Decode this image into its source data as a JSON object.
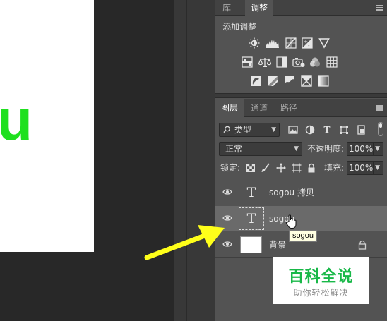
{
  "canvas": {
    "visible_text": "u",
    "text_color": "#1fe01f"
  },
  "adjustments_panel": {
    "tabs": [
      {
        "label": "库",
        "active": false
      },
      {
        "label": "调整",
        "active": true
      }
    ],
    "title": "添加调整",
    "icons": [
      "brightness-contrast-icon",
      "levels-icon",
      "curves-icon",
      "exposure-icon",
      "vibrance-icon",
      "hue-saturation-icon",
      "color-balance-icon",
      "black-white-icon",
      "photo-filter-icon",
      "channel-mixer-icon",
      "color-lookup-icon",
      "invert-icon",
      "posterize-icon",
      "threshold-icon",
      "selective-color-icon",
      "gradient-map-icon"
    ]
  },
  "layers_panel": {
    "tabs": [
      {
        "label": "图层",
        "active": true
      },
      {
        "label": "通道",
        "active": false
      },
      {
        "label": "路径",
        "active": false
      }
    ],
    "filter_kind": "类型",
    "filter_icons": [
      "filter-pixel-icon",
      "filter-adjustment-icon",
      "filter-type-icon",
      "filter-shape-icon",
      "filter-smart-object-icon"
    ],
    "blend_mode": "正常",
    "opacity_label": "不透明度:",
    "opacity_value": "100%",
    "lock_label": "锁定:",
    "lock_icons": [
      "lock-transparent-icon",
      "lock-image-icon",
      "lock-position-icon",
      "lock-artboard-icon",
      "lock-all-icon"
    ],
    "fill_label": "填充:",
    "fill_value": "100%",
    "layers": [
      {
        "name": "sogou 拷贝",
        "type": "text",
        "thumb_glyph": "T",
        "selected": false
      },
      {
        "name": "sogou",
        "type": "text",
        "thumb_glyph": "T",
        "selected": true
      },
      {
        "name": "背景",
        "type": "background",
        "locked": true,
        "selected": false
      }
    ]
  },
  "tooltip": {
    "text": "sogou"
  },
  "annotation": {
    "arrow_color": "#ffff1a"
  },
  "watermark": {
    "title": "百科全说",
    "subtitle": "助你轻松解决",
    "title_color": "#18b848"
  }
}
